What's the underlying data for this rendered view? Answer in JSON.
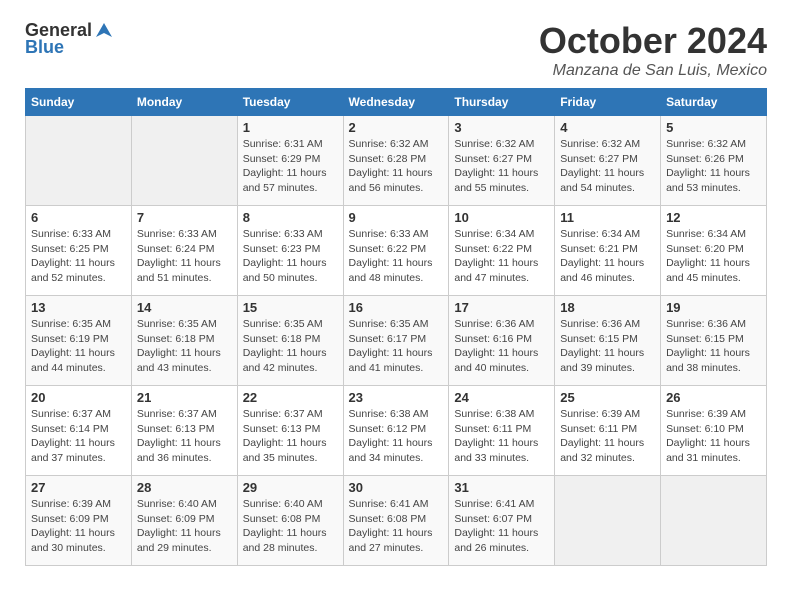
{
  "header": {
    "logo_general": "General",
    "logo_blue": "Blue",
    "month": "October 2024",
    "location": "Manzana de San Luis, Mexico"
  },
  "days_of_week": [
    "Sunday",
    "Monday",
    "Tuesday",
    "Wednesday",
    "Thursday",
    "Friday",
    "Saturday"
  ],
  "weeks": [
    [
      {
        "day": "",
        "info": ""
      },
      {
        "day": "",
        "info": ""
      },
      {
        "day": "1",
        "sunrise": "6:31 AM",
        "sunset": "6:29 PM",
        "daylight": "11 hours and 57 minutes."
      },
      {
        "day": "2",
        "sunrise": "6:32 AM",
        "sunset": "6:28 PM",
        "daylight": "11 hours and 56 minutes."
      },
      {
        "day": "3",
        "sunrise": "6:32 AM",
        "sunset": "6:27 PM",
        "daylight": "11 hours and 55 minutes."
      },
      {
        "day": "4",
        "sunrise": "6:32 AM",
        "sunset": "6:27 PM",
        "daylight": "11 hours and 54 minutes."
      },
      {
        "day": "5",
        "sunrise": "6:32 AM",
        "sunset": "6:26 PM",
        "daylight": "11 hours and 53 minutes."
      }
    ],
    [
      {
        "day": "6",
        "sunrise": "6:33 AM",
        "sunset": "6:25 PM",
        "daylight": "11 hours and 52 minutes."
      },
      {
        "day": "7",
        "sunrise": "6:33 AM",
        "sunset": "6:24 PM",
        "daylight": "11 hours and 51 minutes."
      },
      {
        "day": "8",
        "sunrise": "6:33 AM",
        "sunset": "6:23 PM",
        "daylight": "11 hours and 50 minutes."
      },
      {
        "day": "9",
        "sunrise": "6:33 AM",
        "sunset": "6:22 PM",
        "daylight": "11 hours and 48 minutes."
      },
      {
        "day": "10",
        "sunrise": "6:34 AM",
        "sunset": "6:22 PM",
        "daylight": "11 hours and 47 minutes."
      },
      {
        "day": "11",
        "sunrise": "6:34 AM",
        "sunset": "6:21 PM",
        "daylight": "11 hours and 46 minutes."
      },
      {
        "day": "12",
        "sunrise": "6:34 AM",
        "sunset": "6:20 PM",
        "daylight": "11 hours and 45 minutes."
      }
    ],
    [
      {
        "day": "13",
        "sunrise": "6:35 AM",
        "sunset": "6:19 PM",
        "daylight": "11 hours and 44 minutes."
      },
      {
        "day": "14",
        "sunrise": "6:35 AM",
        "sunset": "6:18 PM",
        "daylight": "11 hours and 43 minutes."
      },
      {
        "day": "15",
        "sunrise": "6:35 AM",
        "sunset": "6:18 PM",
        "daylight": "11 hours and 42 minutes."
      },
      {
        "day": "16",
        "sunrise": "6:35 AM",
        "sunset": "6:17 PM",
        "daylight": "11 hours and 41 minutes."
      },
      {
        "day": "17",
        "sunrise": "6:36 AM",
        "sunset": "6:16 PM",
        "daylight": "11 hours and 40 minutes."
      },
      {
        "day": "18",
        "sunrise": "6:36 AM",
        "sunset": "6:15 PM",
        "daylight": "11 hours and 39 minutes."
      },
      {
        "day": "19",
        "sunrise": "6:36 AM",
        "sunset": "6:15 PM",
        "daylight": "11 hours and 38 minutes."
      }
    ],
    [
      {
        "day": "20",
        "sunrise": "6:37 AM",
        "sunset": "6:14 PM",
        "daylight": "11 hours and 37 minutes."
      },
      {
        "day": "21",
        "sunrise": "6:37 AM",
        "sunset": "6:13 PM",
        "daylight": "11 hours and 36 minutes."
      },
      {
        "day": "22",
        "sunrise": "6:37 AM",
        "sunset": "6:13 PM",
        "daylight": "11 hours and 35 minutes."
      },
      {
        "day": "23",
        "sunrise": "6:38 AM",
        "sunset": "6:12 PM",
        "daylight": "11 hours and 34 minutes."
      },
      {
        "day": "24",
        "sunrise": "6:38 AM",
        "sunset": "6:11 PM",
        "daylight": "11 hours and 33 minutes."
      },
      {
        "day": "25",
        "sunrise": "6:39 AM",
        "sunset": "6:11 PM",
        "daylight": "11 hours and 32 minutes."
      },
      {
        "day": "26",
        "sunrise": "6:39 AM",
        "sunset": "6:10 PM",
        "daylight": "11 hours and 31 minutes."
      }
    ],
    [
      {
        "day": "27",
        "sunrise": "6:39 AM",
        "sunset": "6:09 PM",
        "daylight": "11 hours and 30 minutes."
      },
      {
        "day": "28",
        "sunrise": "6:40 AM",
        "sunset": "6:09 PM",
        "daylight": "11 hours and 29 minutes."
      },
      {
        "day": "29",
        "sunrise": "6:40 AM",
        "sunset": "6:08 PM",
        "daylight": "11 hours and 28 minutes."
      },
      {
        "day": "30",
        "sunrise": "6:41 AM",
        "sunset": "6:08 PM",
        "daylight": "11 hours and 27 minutes."
      },
      {
        "day": "31",
        "sunrise": "6:41 AM",
        "sunset": "6:07 PM",
        "daylight": "11 hours and 26 minutes."
      },
      {
        "day": "",
        "info": ""
      },
      {
        "day": "",
        "info": ""
      }
    ]
  ]
}
